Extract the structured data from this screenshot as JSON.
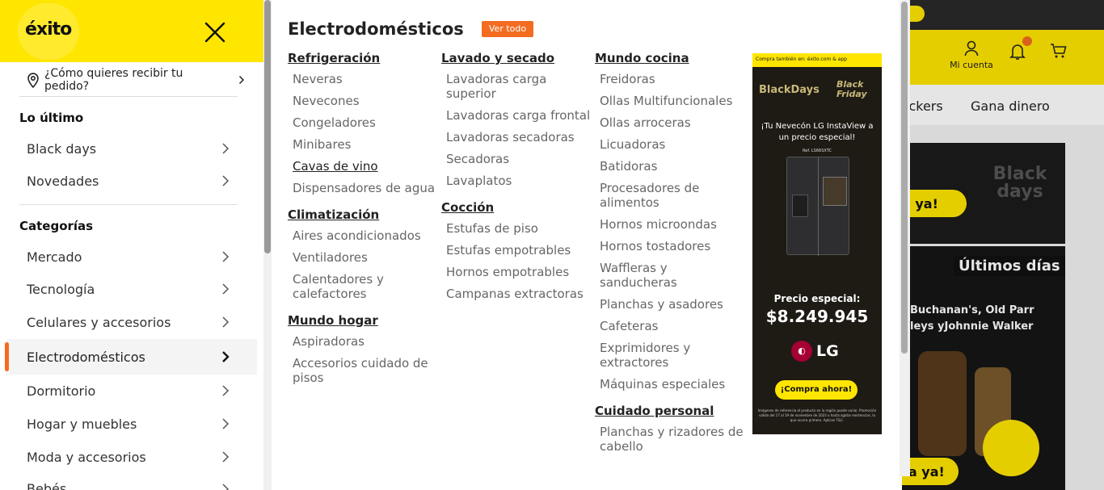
{
  "sidebar": {
    "logo": "éxito",
    "delivery_text": "¿Cómo quieres recibir tu pedido?",
    "lo_ultimo_title": "Lo último",
    "lo_ultimo": [
      "Black days",
      "Novedades"
    ],
    "categorias_title": "Categorías",
    "categorias": [
      "Mercado",
      "Tecnología",
      "Celulares y accesorios",
      "Electrodomésticos",
      "Dormitorio",
      "Hogar y muebles",
      "Moda y accesorios",
      "Bebés"
    ],
    "active_category": "Electrodomésticos"
  },
  "mega": {
    "title": "Electrodomésticos",
    "ver_todo": "Ver todo",
    "col1": [
      {
        "header": "Refrigeración",
        "links": [
          "Neveras",
          "Nevecones",
          "Congeladores",
          "Minibares",
          "Cavas de vino",
          "Dispensadores de agua"
        ]
      },
      {
        "header": "Climatización",
        "links": [
          "Aires acondicionados",
          "Ventiladores",
          "Calentadores y calefactores"
        ]
      },
      {
        "header": "Mundo hogar",
        "links": [
          "Aspiradoras",
          "Accesorios cuidado de pisos"
        ]
      }
    ],
    "col2": [
      {
        "header": "Lavado y secado",
        "links": [
          "Lavadoras carga superior",
          "Lavadoras carga frontal",
          "Lavadoras secadoras",
          "Secadoras",
          "Lavaplatos"
        ]
      },
      {
        "header": "Cocción",
        "links": [
          "Estufas de piso",
          "Estufas empotrables",
          "Hornos empotrables",
          "Campanas extractoras"
        ]
      }
    ],
    "col3": [
      {
        "header": "Mundo cocina",
        "links": [
          "Freidoras",
          "Ollas Multifuncionales",
          "Ollas arroceras",
          "Licuadoras",
          "Batidoras",
          "Procesadores de alimentos",
          "Hornos microondas",
          "Hornos tostadores",
          "Waffleras y sanducheras",
          "Planchas y asadores",
          "Cafeteras",
          "Exprimidores y extractores",
          "Máquinas especiales"
        ]
      },
      {
        "header": "Cuidado personal",
        "links": [
          "Planchas y rizadores de cabello"
        ]
      }
    ],
    "hovered_link": "Cavas de vino"
  },
  "ad": {
    "top_strip": "Compra también en: éxito.com & app",
    "black_days": "BlackDays",
    "black_friday": "Black Friday",
    "promo_line": "¡Tu Nevecón LG InstaView a un precio especial!",
    "ref": "Ref. LS66SXTC",
    "price_title": "Precio especial:",
    "price": "$8.249.945",
    "brand": "LG",
    "button": "¡Compra ahora!",
    "legal": "Imágenes de referencia el producto en la región puede variar. Promoción válida del 17 al 19 de noviembre de 2023 o hasta agotar existencias, lo que ocurra primero. Aplican T&C."
  },
  "background": {
    "account_label": "Mi cuenta",
    "nav": [
      "ickers",
      "Gana dinero"
    ],
    "banner1_cta": "a ya!",
    "banner1_text": "Black days",
    "banner2_title": "Últimos días",
    "banner2_brands": "Buchanan's, Old Parr\nleys yJohnnie Walker",
    "banner2_cta": "ra ya!"
  }
}
